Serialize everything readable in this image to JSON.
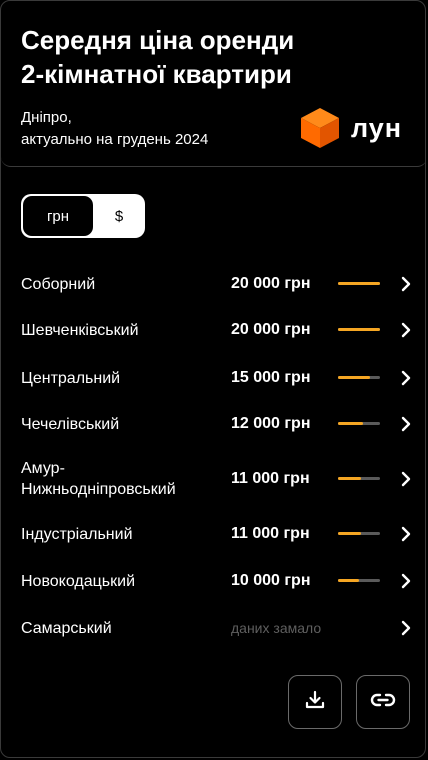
{
  "header": {
    "title_line1": "Середня ціна оренди",
    "title_line2": "2-кімнатної квартири",
    "city": "Дніпро,",
    "date_line": "актуально на грудень 2024",
    "logo_text": "лун",
    "logo_icon": "orange-cube-icon",
    "logo_colors": [
      "#ff6a00",
      "#ff8a1a",
      "#e25500"
    ]
  },
  "currency_toggle": {
    "options": [
      "грн",
      "$"
    ],
    "selected": "грн"
  },
  "accent_color": "#f5a623",
  "districts": [
    {
      "name": "Соборний",
      "price": "20 000 грн",
      "level": 1.0
    },
    {
      "name": "Шевченківський",
      "price": "20 000 грн",
      "level": 1.0
    },
    {
      "name": "Центральний",
      "price": "15 000 грн",
      "level": 0.75
    },
    {
      "name": "Чечелівський",
      "price": "12 000 грн",
      "level": 0.6
    },
    {
      "name": "Амур-\nНижньодніпровський",
      "price": "11 000 грн",
      "level": 0.55
    },
    {
      "name": "Індустріальний",
      "price": "11 000 грн",
      "level": 0.55
    },
    {
      "name": "Новокодацький",
      "price": "10 000 грн",
      "level": 0.5
    },
    {
      "name": "Самарський",
      "price": "",
      "note": "даних замало",
      "level": null
    }
  ],
  "actions": {
    "download_icon": "download-icon",
    "link_icon": "link-icon"
  }
}
